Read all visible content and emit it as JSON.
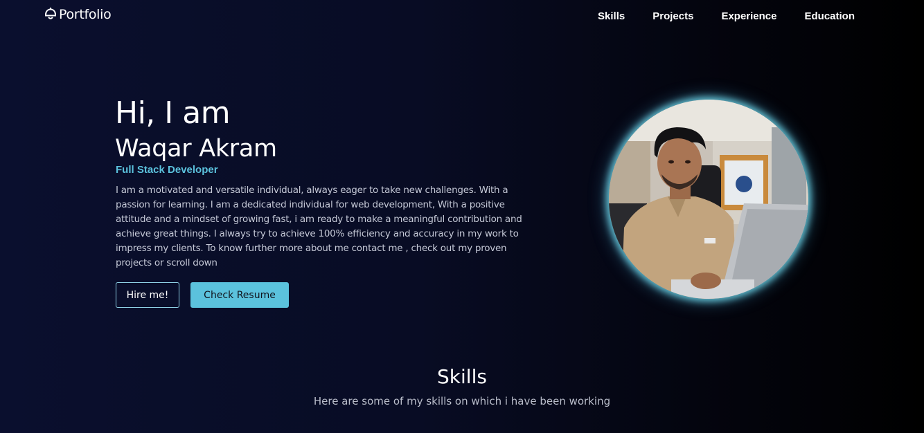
{
  "navbar": {
    "brand": {
      "label": "Portfolio",
      "icon": "bell-icon"
    },
    "links": [
      {
        "label": "Skills"
      },
      {
        "label": "Projects"
      },
      {
        "label": "Experience"
      },
      {
        "label": "Education"
      }
    ]
  },
  "hero": {
    "greeting": "Hi, I am",
    "name": "Waqar Akram",
    "role": "Full Stack Developer",
    "bio": "I am a motivated and versatile individual, always eager to take new challenges. With a passion for learning. I am a dedicated individual for web development, With a positive attitude and a mindset of growing fast, i am ready to make a meaningful contribution and achieve great things. I always try to achieve 100% efficiency and accuracy in my work to impress my clients. To know further more about me contact me , check out my proven projects or scroll down",
    "buttons": {
      "hire": "Hire me!",
      "resume": "Check Resume"
    }
  },
  "skills_section": {
    "title": "Skills",
    "subtitle": "Here are some of my skills on which i have been working"
  },
  "colors": {
    "accent": "#5bc2dd",
    "background": "#080c24",
    "text": "#ffffff"
  }
}
